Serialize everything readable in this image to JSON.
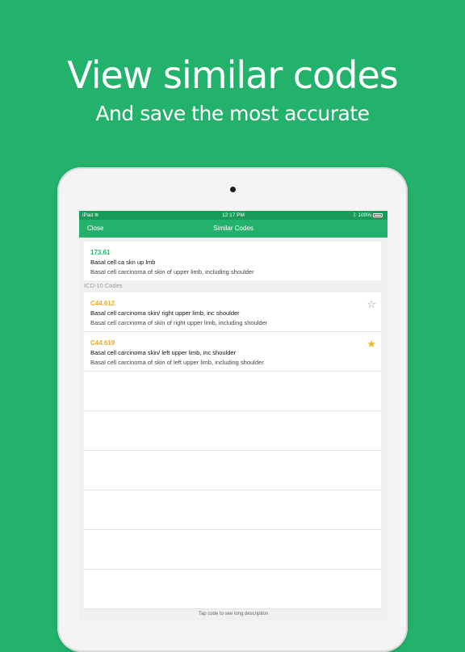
{
  "promo": {
    "headline": "View similar codes",
    "subheadline": "And save the most accurate"
  },
  "status_bar": {
    "carrier": "iPad",
    "time": "12:17 PM",
    "battery": "100%"
  },
  "nav": {
    "close_label": "Close",
    "title": "Similar Codes"
  },
  "primary_code": {
    "code": "173.61",
    "short": "Basal cell ca skn up lmb",
    "long": "Basal cell carcinoma of skin of upper limb, including shoulder"
  },
  "section_header": "ICD-10 Codes",
  "icd10_codes": [
    {
      "code": "C44.612",
      "short": "Basal cell carcinoma skin/ right upper limb, inc shoulder",
      "long": "Basal cell carcinoma of skin of right upper limb, including shoulder",
      "starred": false
    },
    {
      "code": "C44.619",
      "short": "Basal cell carcinoma skin/ left upper limb, inc shoulder",
      "long": "Basal cell carcinoma of skin of left upper limb, including shoulder",
      "starred": true
    }
  ],
  "footer_hint": "Tap code to see long description",
  "colors": {
    "brand_green": "#23b26b",
    "code_orange": "#f0a81c",
    "star_gold": "#f0b81c"
  }
}
